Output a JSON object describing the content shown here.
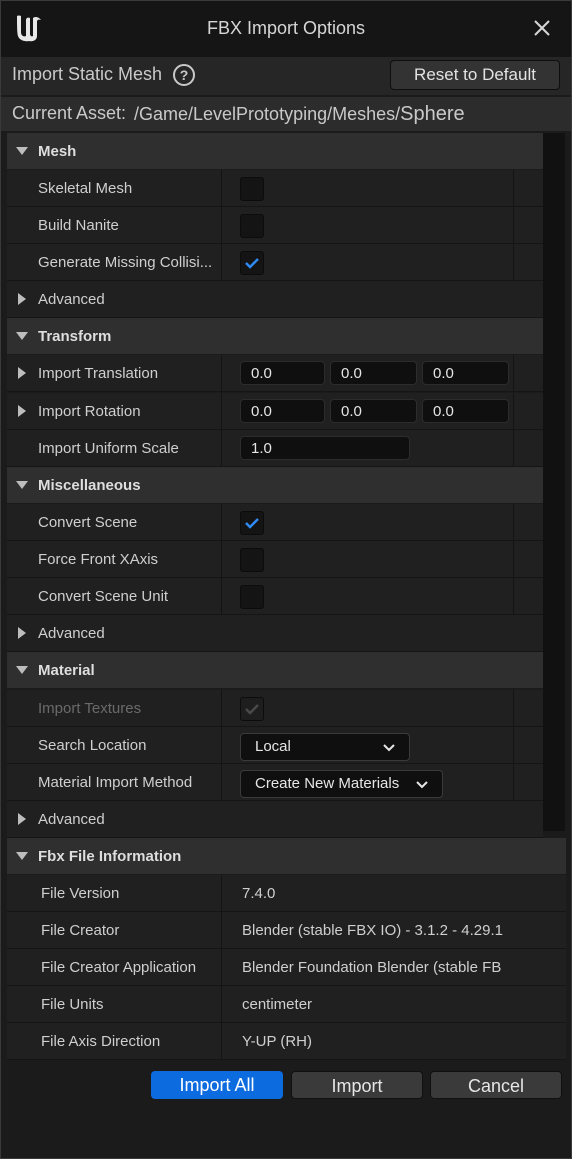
{
  "window": {
    "title": "FBX Import Options"
  },
  "header": {
    "import_type": "Import Static Mesh",
    "reset_label": "Reset to Default",
    "current_asset_label": "Current Asset:",
    "current_asset_path": "/Game/LevelPrototyping/Meshes/",
    "current_asset_name": "Sphere"
  },
  "sections": {
    "mesh": {
      "title": "Mesh",
      "skeletal_mesh": {
        "label": "Skeletal Mesh",
        "checked": false
      },
      "build_nanite": {
        "label": "Build Nanite",
        "checked": false
      },
      "generate_missing_collision": {
        "label": "Generate Missing Collisi...",
        "checked": true
      },
      "advanced": "Advanced"
    },
    "transform": {
      "title": "Transform",
      "import_translation": {
        "label": "Import Translation",
        "x": "0.0",
        "y": "0.0",
        "z": "0.0"
      },
      "import_rotation": {
        "label": "Import Rotation",
        "x": "0.0",
        "y": "0.0",
        "z": "0.0"
      },
      "import_uniform_scale": {
        "label": "Import Uniform Scale",
        "value": "1.0"
      }
    },
    "miscellaneous": {
      "title": "Miscellaneous",
      "convert_scene": {
        "label": "Convert Scene",
        "checked": true
      },
      "force_front_xaxis": {
        "label": "Force Front XAxis",
        "checked": false
      },
      "convert_scene_unit": {
        "label": "Convert Scene Unit",
        "checked": false
      },
      "advanced": "Advanced"
    },
    "material": {
      "title": "Material",
      "import_textures": {
        "label": "Import Textures",
        "checked": true,
        "disabled": true
      },
      "search_location": {
        "label": "Search Location",
        "value": "Local"
      },
      "material_import_method": {
        "label": "Material Import Method",
        "value": "Create New Materials"
      },
      "advanced": "Advanced"
    },
    "fbx_info": {
      "title": "Fbx File Information",
      "rows": [
        {
          "label": "File Version",
          "value": "7.4.0"
        },
        {
          "label": "File Creator",
          "value": "Blender (stable FBX IO) - 3.1.2 - 4.29.1"
        },
        {
          "label": "File Creator Application",
          "value": "Blender Foundation Blender (stable FB"
        },
        {
          "label": "File Units",
          "value": "centimeter"
        },
        {
          "label": "File Axis Direction",
          "value": "Y-UP (RH)"
        }
      ]
    }
  },
  "footer": {
    "import_all": "Import All",
    "import": "Import",
    "cancel": "Cancel"
  },
  "colors": {
    "accent": "#0d6be0",
    "checkmark": "#2f8bf5"
  }
}
